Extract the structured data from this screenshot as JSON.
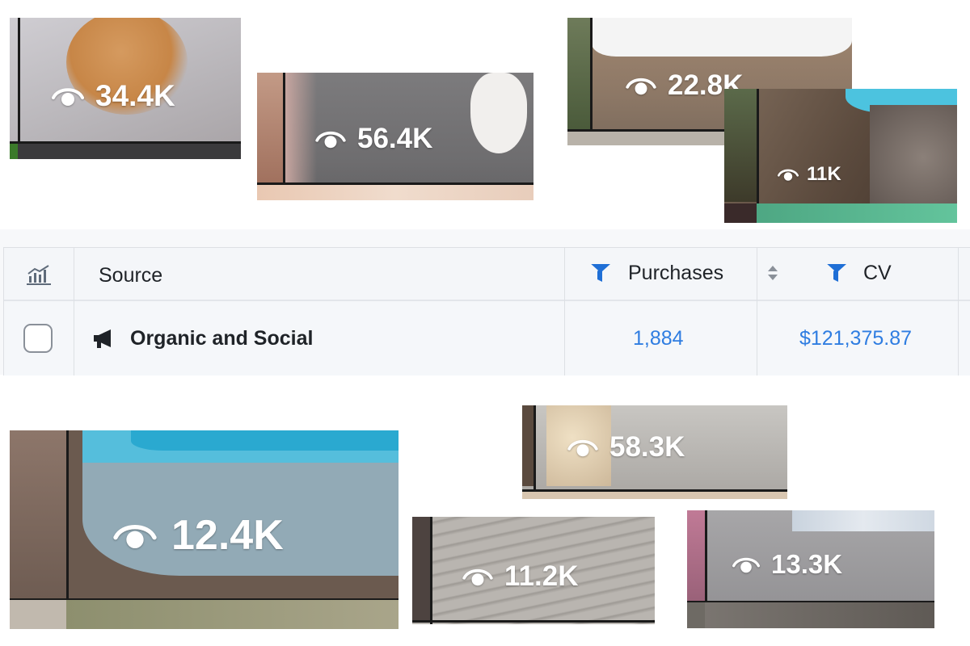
{
  "tiles": [
    {
      "views": "34.4K"
    },
    {
      "views": "56.4K"
    },
    {
      "views": "22.8K"
    },
    {
      "views": "11K"
    },
    {
      "views": "12.4K"
    },
    {
      "views": "58.3K"
    },
    {
      "views": "11.2K"
    },
    {
      "views": "13.3K"
    }
  ],
  "table": {
    "headers": {
      "chart_icon": "bar-chart-icon",
      "source": "Source",
      "purchases": "Purchases",
      "cv": "CV",
      "filter_icon": "funnel-icon",
      "sort_icon": "sort-arrows-icon"
    },
    "rows": [
      {
        "icon": "megaphone-icon",
        "source": "Organic and Social",
        "purchases": "1,884",
        "cv": "$121,375.87"
      }
    ]
  },
  "colors": {
    "accent": "#2f7de1",
    "filter_icon": "#1f6fd6",
    "text": "#1f2328"
  }
}
